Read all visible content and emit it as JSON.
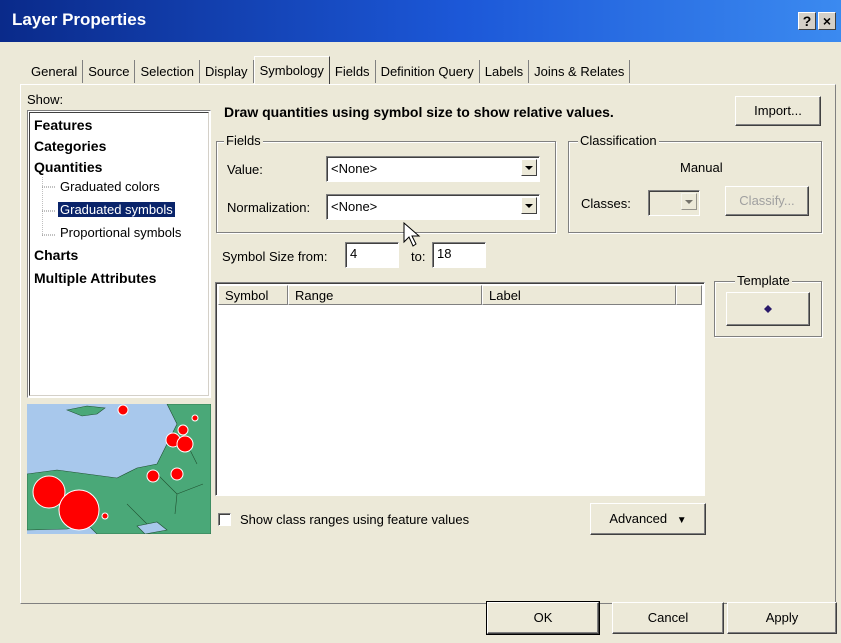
{
  "window": {
    "title": "Layer Properties",
    "help_label": "?",
    "close_label": "×"
  },
  "tabs": [
    {
      "label": "General"
    },
    {
      "label": "Source"
    },
    {
      "label": "Selection"
    },
    {
      "label": "Display"
    },
    {
      "label": "Symbology",
      "active": true
    },
    {
      "label": "Fields"
    },
    {
      "label": "Definition Query"
    },
    {
      "label": "Labels"
    },
    {
      "label": "Joins & Relates"
    }
  ],
  "show": {
    "label": "Show:",
    "items": [
      {
        "label": "Features",
        "level": 0
      },
      {
        "label": "Categories",
        "level": 0
      },
      {
        "label": "Quantities",
        "level": 0
      },
      {
        "label": "Graduated colors",
        "level": 1
      },
      {
        "label": "Graduated symbols",
        "level": 1,
        "selected": true
      },
      {
        "label": "Proportional symbols",
        "level": 1
      },
      {
        "label": "Charts",
        "level": 0
      },
      {
        "label": "Multiple Attributes",
        "level": 0
      }
    ]
  },
  "description": "Draw quantities using symbol size to show relative values.",
  "import_button": "Import...",
  "fields": {
    "group_label": "Fields",
    "value_label": "Value:",
    "value": "<None>",
    "normalization_label": "Normalization:",
    "normalization": "<None>"
  },
  "classification": {
    "group_label": "Classification",
    "method": "Manual",
    "classes_label": "Classes:",
    "classes_value": "",
    "classify_button": "Classify..."
  },
  "symbol_size": {
    "from_label": "Symbol Size from:",
    "from_value": "4",
    "to_label": "to:",
    "to_value": "18"
  },
  "template": {
    "label": "Template",
    "symbol_color": "#2a1a6a"
  },
  "table": {
    "columns": [
      "Symbol",
      "Range",
      "Label"
    ],
    "rows": []
  },
  "show_class_ranges": {
    "label": "Show class ranges using feature values",
    "checked": false
  },
  "advanced_button": "Advanced",
  "footer": {
    "ok": "OK",
    "cancel": "Cancel",
    "apply": "Apply"
  },
  "colors": {
    "title_bar": "#1c58d8",
    "selection": "#0a246a",
    "map_water": "#a8c8ec",
    "map_land": "#4aa878",
    "map_symbol": "#ff0000"
  }
}
